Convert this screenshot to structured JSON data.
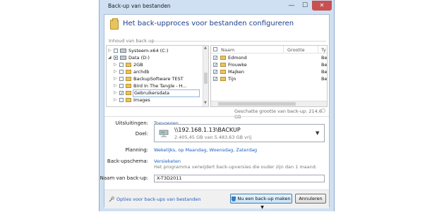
{
  "window": {
    "title": "Back-up van bestanden",
    "min_glyph": "—",
    "max_glyph": "☐",
    "close_glyph": "✕"
  },
  "header": {
    "title": "Het back-upproces voor bestanden configureren"
  },
  "content": {
    "section_label": "Inhoud van back-up",
    "tree": [
      {
        "label": "Systeem-x64 (C:)",
        "type": "drive",
        "expander": "▷",
        "check": "none"
      },
      {
        "label": "Data (D:)",
        "type": "drive",
        "expander": "◢",
        "check": "mixed"
      },
      {
        "label": "2GB",
        "type": "folder",
        "expander": "▷",
        "check": "none"
      },
      {
        "label": "archdb",
        "type": "folder",
        "expander": "▷",
        "check": "none"
      },
      {
        "label": "BackupSoftware TEST",
        "type": "folder",
        "expander": "▷",
        "check": "none"
      },
      {
        "label": "Bird In The Tangle - H...",
        "type": "folder",
        "expander": "▷",
        "check": "none"
      },
      {
        "label": "Gebruikersdata",
        "type": "folder",
        "expander": "▷",
        "check": "checked",
        "selected": true
      },
      {
        "label": "Images",
        "type": "folder",
        "expander": "▷",
        "check": "none"
      }
    ],
    "list_columns": [
      "Naam",
      "Grootte",
      "Ty"
    ],
    "list_items": [
      {
        "name": "Edmond",
        "type": "Be"
      },
      {
        "name": "Frouwke",
        "type": "Be"
      },
      {
        "name": "Majken",
        "type": "Be"
      },
      {
        "name": "Tijn",
        "type": "Be"
      }
    ],
    "size_estimate": "Geschatte grootte van back-up: 214,6 GB"
  },
  "form": {
    "exclusions_label": "Uitsluitingen:",
    "exclusions_link": "Toevoegen",
    "destination_label": "Doel:",
    "destination_path": "\\\\192.168.1.13\\BACKUP",
    "destination_free": "2.405,45 GB van 5.483,63 GB vrij",
    "schedule_label": "Planning:",
    "schedule_link": "Wekelijks, op Maandag, Woensdag, Zaterdag",
    "scheme_label": "Back-upschema:",
    "scheme_link": "Versieketen",
    "scheme_desc": "Het programma verwijdert back-upversies die ouder zijn dan 1 maand.",
    "name_label": "Naam van back-up:",
    "name_value": "X-T3D2011"
  },
  "footer": {
    "options_link": "Opties voor back-ups van bestanden",
    "backup_now": "Nu een back-up maken",
    "cancel": "Annuleren"
  }
}
